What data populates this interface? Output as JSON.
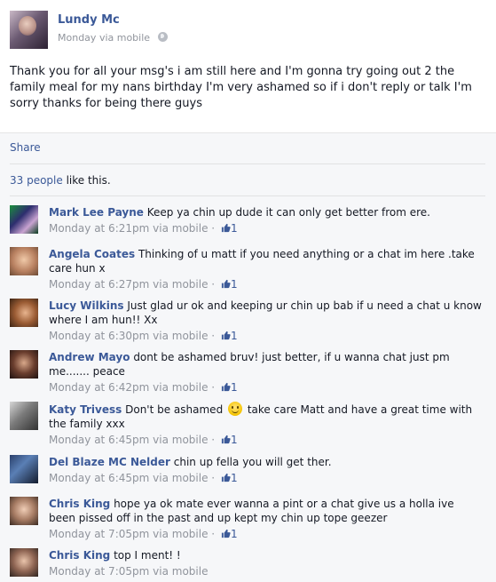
{
  "post": {
    "author": "Lundy Mc",
    "timestamp": "Monday",
    "via": "via mobile",
    "privacy_icon": "globe-icon",
    "status": "Thank you for all your msg's i am still here and I'm gonna try going out 2 the family meal for my nans birthday I'm very ashamed so if i don't reply or talk I'm sorry thanks for being there guys"
  },
  "actions": {
    "share_label": "Share"
  },
  "likes": {
    "count_link": "33 people",
    "suffix": " like this."
  },
  "comments": [
    {
      "name": "Mark Lee Payne",
      "text": "Keep ya chin up dude it can only get better from ere.",
      "time": "Monday at 6:21pm",
      "via": "via mobile",
      "likes": "1"
    },
    {
      "name": "Angela Coates",
      "text": "Thinking of u matt if you need anything or a chat im here .take care hun x",
      "time": "Monday at 6:27pm",
      "via": "via mobile",
      "likes": "1"
    },
    {
      "name": "Lucy Wilkins",
      "text": "Just glad ur ok and keeping ur chin up bab if u need a chat u know where I am hun!! Xx",
      "time": "Monday at 6:30pm",
      "via": "via mobile",
      "likes": "1"
    },
    {
      "name": "Andrew Mayo",
      "text": "dont be ashamed bruv! just better, if u wanna chat just pm me....... peace",
      "time": "Monday at 6:42pm",
      "via": "via mobile",
      "likes": "1"
    },
    {
      "name": "Katy Trivess",
      "text_before": "Don't be ashamed",
      "text_after": "take care Matt and have a great time with the family xxx",
      "time": "Monday at 6:45pm",
      "via": "via mobile",
      "likes": "1"
    },
    {
      "name": "Del Blaze MC Nelder",
      "text": "chin up fella you will get ther.",
      "time": "Monday at 6:45pm",
      "via": "via mobile",
      "likes": "1"
    },
    {
      "name": "Chris King",
      "text": "hope ya ok mate ever wanna a pint or a chat give us a holla ive been pissed off in the past and up kept my chin up tope geezer",
      "time": "Monday at 7:05pm",
      "via": "via mobile",
      "likes": "1"
    },
    {
      "name": "Chris King",
      "text": "top I ment! !",
      "time": "Monday at 7:05pm",
      "via": "via mobile"
    }
  ],
  "colors": {
    "link": "#3b5998",
    "meta": "#90949c",
    "ufi_background": "#f6f7f9"
  }
}
